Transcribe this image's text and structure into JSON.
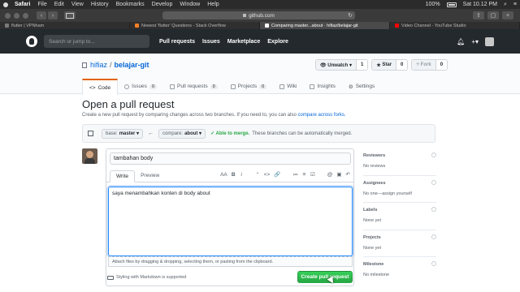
{
  "menubar": {
    "app": "Safari",
    "items": [
      "File",
      "Edit",
      "View",
      "History",
      "Bookmarks",
      "Develop",
      "Window",
      "Help"
    ],
    "battery": "100%",
    "clock": "Sat 10.12 PM"
  },
  "browser": {
    "url": "github.com",
    "tabs": [
      {
        "title": "flutter | VPNham",
        "color": "#7a7a7a"
      },
      {
        "title": "Newest 'flutter' Questions - Stack Overflow",
        "color": "#f48024"
      },
      {
        "title": "Comparing master...about · hifiaz/belajar-git",
        "color": "#ffffff"
      },
      {
        "title": "Video Channel - YouTube Studio",
        "color": "#ff0000"
      }
    ]
  },
  "github": {
    "search_placeholder": "Search or jump to...",
    "nav": [
      "Pull requests",
      "Issues",
      "Marketplace",
      "Explore"
    ],
    "add_label": "+▾"
  },
  "repo": {
    "owner": "hifiaz",
    "separator": "/",
    "name": "belajar-git",
    "watch_label": "Unwatch ▾",
    "watch_count": "1",
    "star_label": "Star",
    "star_count": "0",
    "fork_label": "Fork",
    "fork_count": "0",
    "nav": [
      {
        "label": "Code",
        "count": ""
      },
      {
        "label": "Issues",
        "count": "0"
      },
      {
        "label": "Pull requests",
        "count": "0"
      },
      {
        "label": "Projects",
        "count": "0"
      },
      {
        "label": "Wiki",
        "count": ""
      },
      {
        "label": "Insights",
        "count": ""
      },
      {
        "label": "Settings",
        "count": ""
      }
    ]
  },
  "page": {
    "title": "Open a pull request",
    "subtitle": "Create a new pull request by comparing changes across two branches. If you need to, you can also",
    "subtitle_link": "compare across forks."
  },
  "compare": {
    "base_prefix": "base:",
    "base_branch": "master ▾",
    "arrow": "←",
    "compare_prefix": "compare:",
    "compare_branch": "about ▾",
    "merge_status": "✓ Able to merge.",
    "merge_text": "These branches can be automatically merged."
  },
  "editor": {
    "title_value": "tambahan body",
    "tabs": [
      "Write",
      "Preview"
    ],
    "tools": [
      "AA",
      "B",
      "i",
      "“",
      "<>",
      "🔗",
      "≔",
      "≡",
      "☑",
      "@",
      "▣",
      "↶"
    ],
    "body_value": "saya menambahkan konten di body about",
    "attach_text": "Attach files by dragging & dropping, selecting them, or pasting from the clipboard.",
    "markdown_note": "Styling with Markdown is supported",
    "submit_label": "Create pull request"
  },
  "sidebar": [
    {
      "title": "Reviewers",
      "value": "No reviews"
    },
    {
      "title": "Assignees",
      "value": "No one—assign yourself"
    },
    {
      "title": "Labels",
      "value": "None yet"
    },
    {
      "title": "Projects",
      "value": "None yet"
    },
    {
      "title": "Milestone",
      "value": "No milestone"
    }
  ]
}
